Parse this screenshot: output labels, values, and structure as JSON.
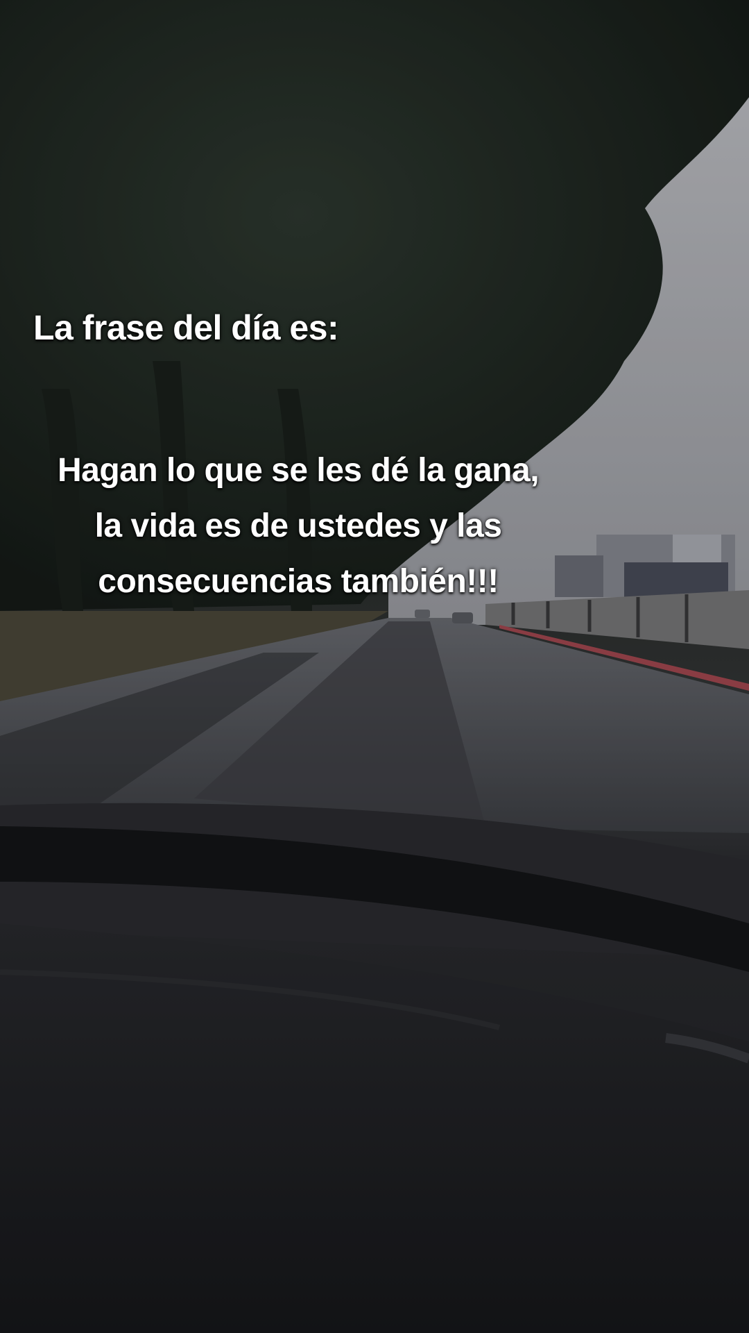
{
  "caption": {
    "title": "La frase del día es:",
    "quote_lines": [
      "Hagan lo que se les dé la gana,",
      "la vida es de ustedes y las",
      "consecuencias también!!!"
    ]
  },
  "colors": {
    "text": "#ffffff",
    "sky": "#cfd0d6",
    "foliage": "#1e2a22",
    "road": "#4e5056",
    "dashboard": "#1b1c1f",
    "curb": "#a84a52"
  }
}
